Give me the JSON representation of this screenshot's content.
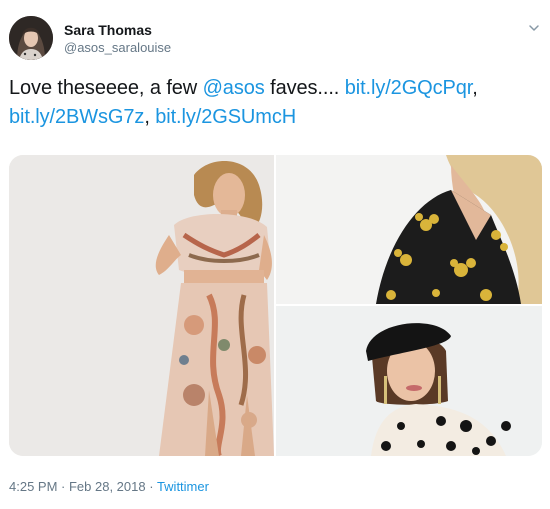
{
  "user": {
    "display_name": "Sara Thomas",
    "handle": "@asos_saralouise"
  },
  "tweet": {
    "text_intro": "Love theseeee, a few ",
    "mention": "@asos",
    "text_mid": " faves.... ",
    "link1": "bit.ly/2GQcPqr",
    "sep1": ", ",
    "link2": "bit.ly/2BWsG7z",
    "sep2": ", ",
    "link3": "bit.ly/2GSUmcH"
  },
  "meta": {
    "time": "4:25 PM",
    "dot1": " · ",
    "date": "Feb 28, 2018",
    "dot2": " · ",
    "source": "Twittimer"
  },
  "colors": {
    "link": "#1b95e0",
    "text": "#14171a",
    "secondary": "#657786"
  },
  "icons": {
    "caret": "chevron-down-icon"
  }
}
